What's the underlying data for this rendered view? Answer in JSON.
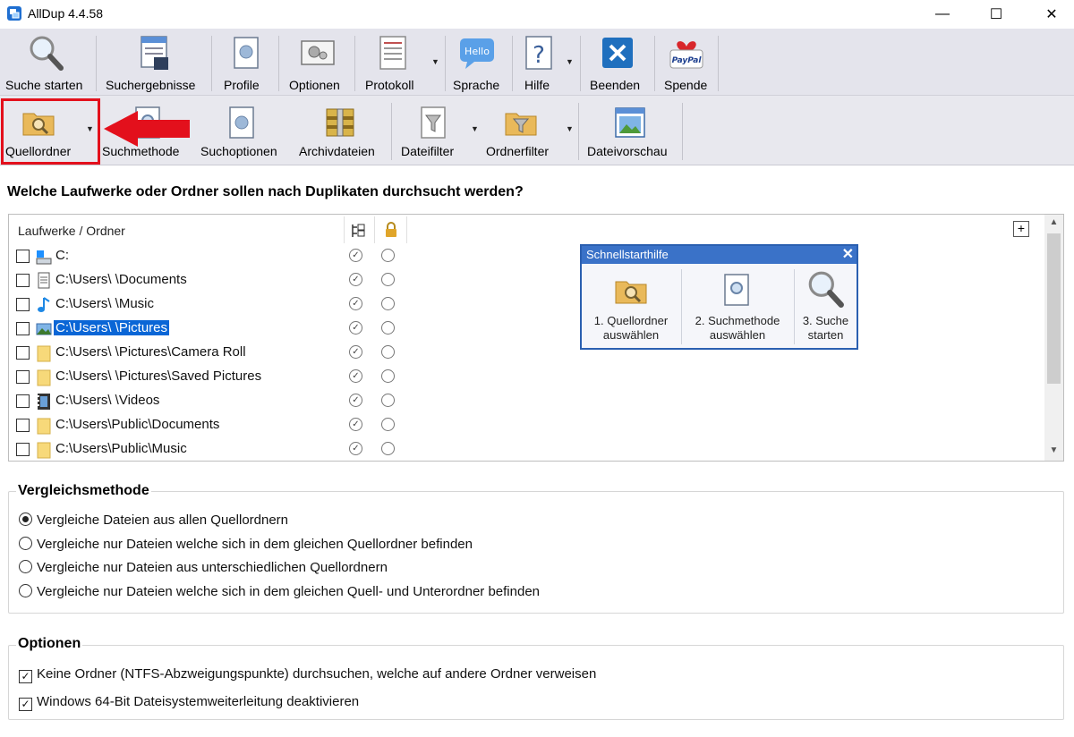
{
  "window": {
    "title": "AllDup 4.4.58",
    "minimize_glyph": "—",
    "maximize_glyph": "☐",
    "close_glyph": "✕"
  },
  "toolbar_main": {
    "buttons": [
      {
        "label": "Suche starten",
        "icon": "magnifier-icon"
      },
      {
        "label": "Suchergebnisse",
        "icon": "results-icon"
      },
      {
        "label": "Profile",
        "icon": "profile-icon"
      },
      {
        "label": "Optionen",
        "icon": "options-icon"
      },
      {
        "label": "Protokoll",
        "icon": "log-icon"
      },
      {
        "label": "Sprache",
        "icon": "hello-icon"
      },
      {
        "label": "Hilfe",
        "icon": "help-icon"
      },
      {
        "label": "Beenden",
        "icon": "exit-icon"
      },
      {
        "label": "Spende",
        "icon": "paypal-icon"
      }
    ],
    "sprache_badge": "Hello",
    "paypal_badge": "PayPal"
  },
  "toolbar_tabs": {
    "buttons": [
      {
        "label": "Quellordner",
        "icon": "folder-search-icon"
      },
      {
        "label": "Suchmethode",
        "icon": "search-method-icon"
      },
      {
        "label": "Suchoptionen",
        "icon": "search-options-icon"
      },
      {
        "label": "Archivdateien",
        "icon": "archive-icon"
      },
      {
        "label": "Dateifilter",
        "icon": "file-filter-icon"
      },
      {
        "label": "Ordnerfilter",
        "icon": "folder-filter-icon"
      },
      {
        "label": "Dateivorschau",
        "icon": "preview-icon"
      }
    ],
    "highlight_color": "#e3101c"
  },
  "heading": "Welche Laufwerke oder Ordner sollen nach Duplikaten durchsucht werden?",
  "folder_list": {
    "column_header": "Laufwerke / Ordner",
    "rows": [
      {
        "path": "C:",
        "icon": "drive-icon",
        "selected": false
      },
      {
        "path": "C:\\Users\\             \\Documents",
        "icon": "document-icon",
        "selected": false
      },
      {
        "path": "C:\\Users\\             \\Music",
        "icon": "music-note-icon",
        "selected": false
      },
      {
        "path": "C:\\Users\\             \\Pictures",
        "icon": "pictures-icon",
        "selected": true
      },
      {
        "path": "C:\\Users\\             \\Pictures\\Camera Roll",
        "icon": "folder-icon",
        "selected": false
      },
      {
        "path": "C:\\Users\\             \\Pictures\\Saved Pictures",
        "icon": "folder-icon",
        "selected": false
      },
      {
        "path": "C:\\Users\\             \\Videos",
        "icon": "video-icon",
        "selected": false
      },
      {
        "path": "C:\\Users\\Public\\Documents",
        "icon": "folder-icon",
        "selected": false
      },
      {
        "path": "C:\\Users\\Public\\Music",
        "icon": "folder-icon",
        "selected": false
      }
    ],
    "plus_label": "+",
    "check_glyph": "✓"
  },
  "quickstart": {
    "title": "Schnellstarthilfe",
    "close": "✕",
    "steps": [
      {
        "line1": "1. Quellordner",
        "line2": "auswählen"
      },
      {
        "line1": "2. Suchmethode",
        "line2": "auswählen"
      },
      {
        "line1": "3. Suche",
        "line2": "starten"
      }
    ]
  },
  "compare_method": {
    "title": "Vergleichsmethode",
    "options": [
      {
        "label": "Vergleiche Dateien aus allen Quellordnern",
        "selected": true
      },
      {
        "label": "Vergleiche nur Dateien welche sich in dem gleichen Quellordner befinden",
        "selected": false
      },
      {
        "label": "Vergleiche nur Dateien aus unterschiedlichen Quellordnern",
        "selected": false
      },
      {
        "label": "Vergleiche nur Dateien welche sich in dem gleichen Quell- und Unterordner befinden",
        "selected": false
      }
    ]
  },
  "options": {
    "title": "Optionen",
    "items": [
      {
        "label": "Keine Ordner (NTFS-Abzweigungspunkte) durchsuchen, welche auf andere Ordner verweisen",
        "checked": true
      },
      {
        "label": "Windows 64-Bit Dateisystemweiterleitung deaktivieren",
        "checked": true
      }
    ],
    "check_glyph": "✓"
  }
}
